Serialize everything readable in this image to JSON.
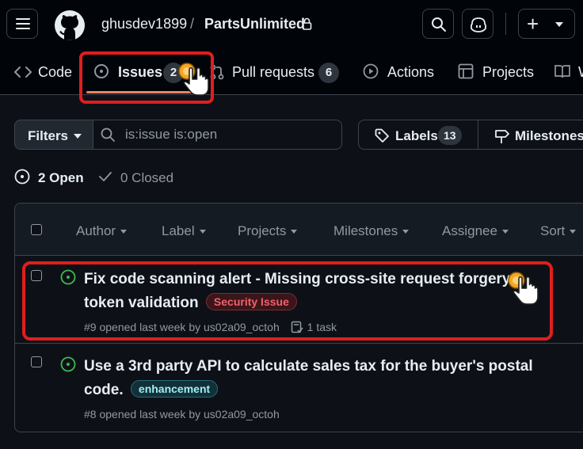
{
  "header": {
    "owner": "ghusdev1899",
    "separator": "/",
    "repo": "PartsUnlimited"
  },
  "repo_nav": {
    "tabs": [
      {
        "label": "Code",
        "icon": "code-icon"
      },
      {
        "label": "Issues",
        "count": "2",
        "icon": "issue-opened-icon"
      },
      {
        "label": "Pull requests",
        "count": "6",
        "icon": "git-pull-request-icon"
      },
      {
        "label": "Actions",
        "icon": "play-icon"
      },
      {
        "label": "Projects",
        "icon": "table-icon"
      },
      {
        "label": "W",
        "icon": "book-icon"
      }
    ]
  },
  "filters": {
    "filters_label": "Filters",
    "search_value": "is:issue is:open",
    "labels_label": "Labels",
    "labels_count": "13",
    "milestones_label": "Milestones"
  },
  "state": {
    "open_label": "2 Open",
    "closed_label": "0 Closed"
  },
  "columns": [
    "Author",
    "Label",
    "Projects",
    "Milestones",
    "Assignee",
    "Sort"
  ],
  "issues": [
    {
      "title": "Fix code scanning alert - Missing cross-site request forgery token validation",
      "label": "Security Issue",
      "meta": "#9 opened last week by us02a09_octoh",
      "task": "1 task"
    },
    {
      "title": "Use a 3rd party API to calculate sales tax for the buyer's postal code.",
      "label": "enhancement",
      "meta": "#8 opened last week by us02a09_octoh"
    }
  ],
  "colors": {
    "background": "#0d1117",
    "header_bg": "#010409",
    "border": "#3d444d",
    "open_green": "#3fb950",
    "highlight_red": "#e01e1e",
    "tab_underline": "#f78166",
    "click_marker": "#f5a623"
  }
}
